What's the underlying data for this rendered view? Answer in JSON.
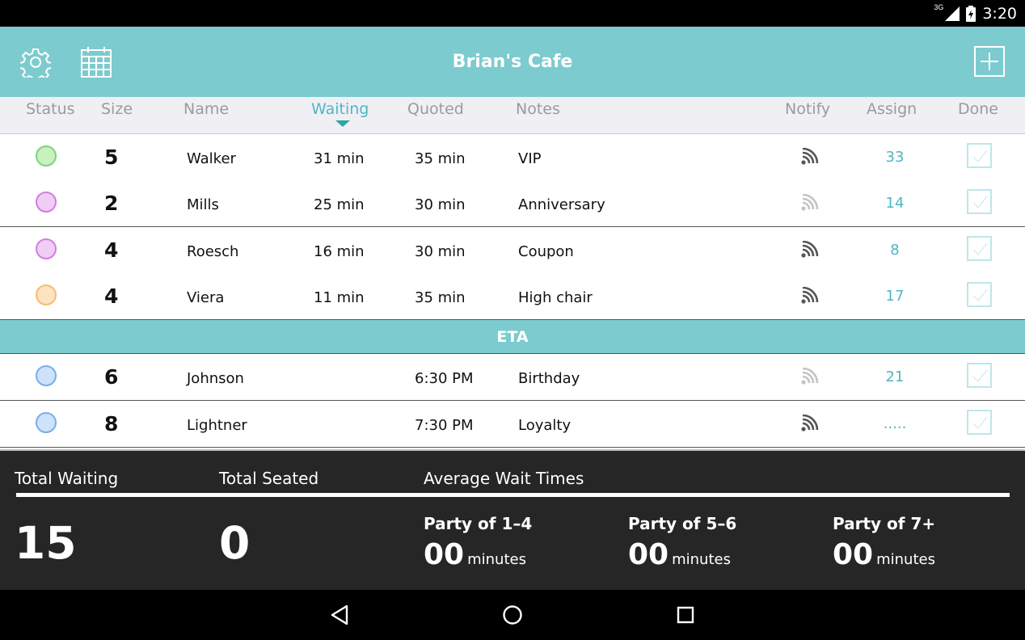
{
  "status_bar": {
    "network": "3G",
    "time": "3:20"
  },
  "app": {
    "title": "Brian's Cafe"
  },
  "columns": {
    "status": "Status",
    "size": "Size",
    "name": "Name",
    "waiting": "Waiting",
    "quoted": "Quoted",
    "notes": "Notes",
    "notify": "Notify",
    "assign": "Assign",
    "done": "Done"
  },
  "waiting_rows": [
    {
      "status_color": "#c8f0c0",
      "status_border": "#7fd27a",
      "size": "5",
      "name": "Walker",
      "waiting": "31 min",
      "quoted": "35 min",
      "notes": "VIP",
      "notify_active": true,
      "assign": "33"
    },
    {
      "status_color": "#efcdf4",
      "status_border": "#cf7fe0",
      "size": "2",
      "name": "Mills",
      "waiting": "25 min",
      "quoted": "30 min",
      "notes": "Anniversary",
      "notify_active": false,
      "assign": "14"
    },
    {
      "status_color": "#efcdf4",
      "status_border": "#cf7fe0",
      "size": "4",
      "name": "Roesch",
      "waiting": "16 min",
      "quoted": "30 min",
      "notes": "Coupon",
      "notify_active": true,
      "assign": "8"
    },
    {
      "status_color": "#fde3c0",
      "status_border": "#f5bd72",
      "size": "4",
      "name": "Viera",
      "waiting": "11 min",
      "quoted": "35 min",
      "notes": "High chair",
      "notify_active": true,
      "assign": "17"
    }
  ],
  "eta_label": "ETA",
  "eta_rows": [
    {
      "status_color": "#cde2fb",
      "status_border": "#79aee8",
      "size": "6",
      "name": "Johnson",
      "waiting": "",
      "quoted": "6:30 PM",
      "notes": "Birthday",
      "notify_active": false,
      "assign": "21"
    },
    {
      "status_color": "#cde2fb",
      "status_border": "#79aee8",
      "size": "8",
      "name": "Lightner",
      "waiting": "",
      "quoted": "7:30 PM",
      "notes": "Loyalty",
      "notify_active": true,
      "assign": "....."
    }
  ],
  "summary": {
    "total_waiting_label": "Total Waiting",
    "total_waiting": "15",
    "total_seated_label": "Total Seated",
    "total_seated": "0",
    "avg_label": "Average Wait Times",
    "parties": [
      {
        "label": "Party of 1–4",
        "value": "00",
        "unit": "minutes"
      },
      {
        "label": "Party of 5–6",
        "value": "00",
        "unit": "minutes"
      },
      {
        "label": "Party of 7+",
        "value": "00",
        "unit": "minutes"
      }
    ]
  },
  "colors": {
    "accent": "#7ccbcf",
    "assign_text": "#4fb6c4",
    "footer_bg": "#262626"
  },
  "icons": {
    "settings": "gear-icon",
    "calendar": "calendar-icon",
    "add": "add-icon",
    "notify": "wifi-signal-icon",
    "done": "checkbox-icon",
    "back": "back-triangle-icon",
    "home": "home-circle-icon",
    "recents": "recents-square-icon"
  }
}
